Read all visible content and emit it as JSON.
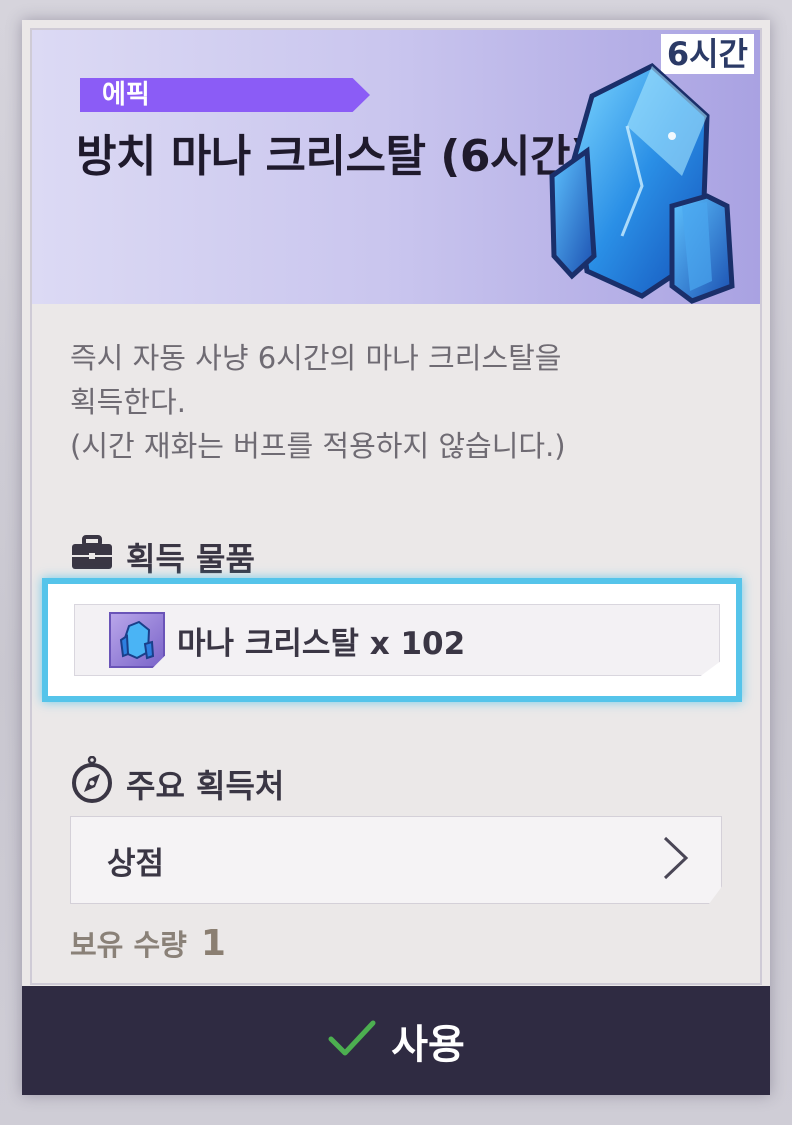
{
  "header": {
    "duration_tag": "6시간",
    "grade": "에픽",
    "title": "방치 마나 크리스탈 (6시간)",
    "accent_color": "#8b5cf6"
  },
  "description": {
    "lines": [
      "즉시 자동 사냥 6시간의 마나 크리스탈을",
      "획득한다.",
      "(시간 재화는 버프를 적용하지 않습니다.)"
    ]
  },
  "rewards": {
    "title": "획득 물품",
    "icon": "briefcase-icon",
    "items": [
      {
        "label": "마나 크리스탈 x 102",
        "icon": "mana-crystal-icon"
      }
    ],
    "highlight_color": "#55c4ea"
  },
  "sources": {
    "title": "주요 획득처",
    "icon": "compass-icon",
    "items": [
      {
        "label": "상점",
        "icon": "chevron-right-icon"
      }
    ]
  },
  "owned": {
    "label": "보유 수량",
    "value": "1"
  },
  "action": {
    "label": "사용",
    "icon": "checkmark-icon",
    "check_color": "#4caf50"
  }
}
